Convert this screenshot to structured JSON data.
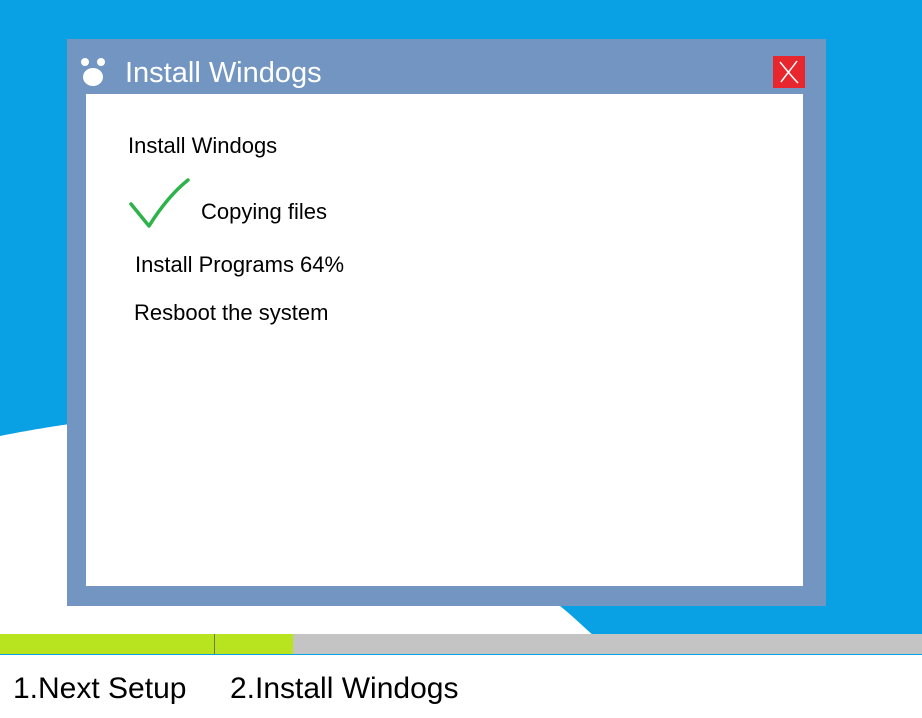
{
  "window": {
    "title": "Install Windogs",
    "close_icon": "close-icon"
  },
  "content": {
    "heading": "Install Windogs",
    "steps": [
      {
        "label": "Copying files",
        "status": "done",
        "icon": "checkmark-icon"
      },
      {
        "label": "Install Programs 64%",
        "status": "in-progress"
      },
      {
        "label": "Resboot the system",
        "status": "pending"
      }
    ]
  },
  "progress": {
    "fraction": 0.318,
    "fill_color": "#b7e41e",
    "track_color": "#c4c4c4"
  },
  "footer": {
    "steps": [
      "1.Next Setup",
      "2.Install Windogs"
    ]
  },
  "colors": {
    "desktop": "#0aa0e4",
    "window_frame": "#7395c2",
    "close_button": "#e8262d",
    "check": "#2db34a"
  }
}
